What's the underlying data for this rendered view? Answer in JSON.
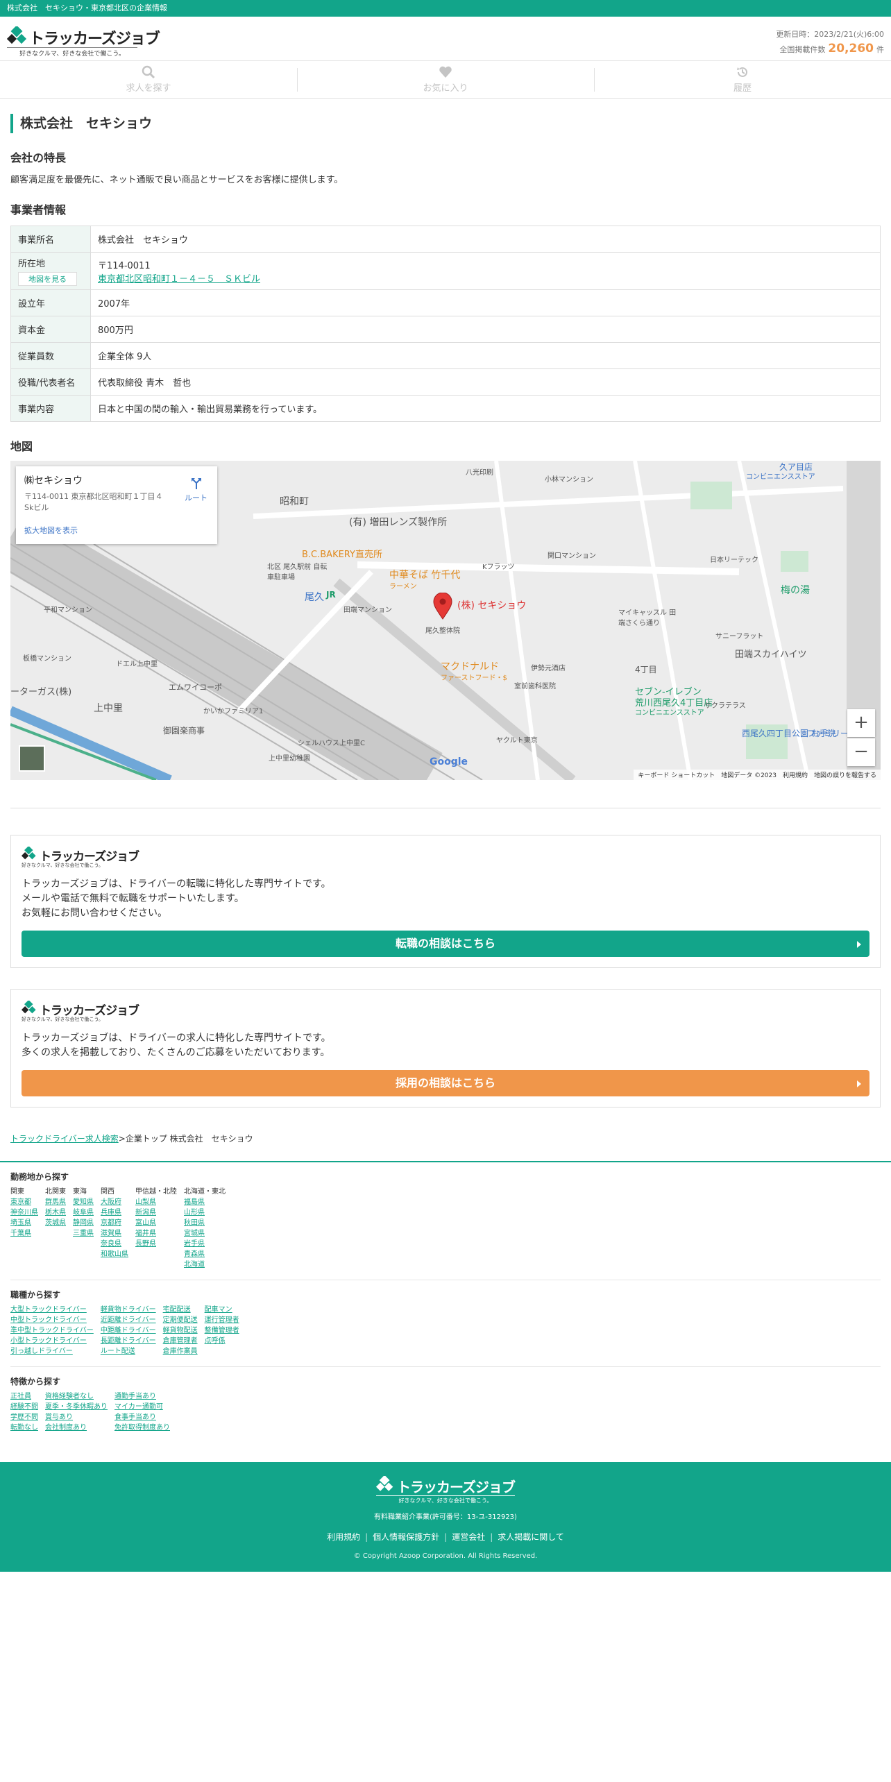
{
  "topbar": {
    "text": "株式会社　セキショウ・東京都北区の企業情報"
  },
  "brand": {
    "name": "トラッカーズジョブ",
    "tagline": "好きなクルマ、好きな会社で働こう。",
    "color": "#12a58a",
    "accent": "#f0964a"
  },
  "header": {
    "updated": "更新日時：2023/2/21(火)6:00",
    "count_label": "全国掲載件数",
    "count": "20,260",
    "count_unit": "件"
  },
  "nav": [
    {
      "label": "求人を探す",
      "icon": "search-icon"
    },
    {
      "label": "お気に入り",
      "icon": "heart-icon"
    },
    {
      "label": "履歴",
      "icon": "history-icon"
    }
  ],
  "company": {
    "title": "株式会社　セキショウ",
    "feature_heading": "会社の特長",
    "feature_text": "顧客満足度を最優先に、ネット通販で良い商品とサービスをお客様に提供します。",
    "info_heading": "事業者情報",
    "rows": [
      {
        "label": "事業所名",
        "value": "株式会社　セキショウ"
      },
      {
        "label": "所在地",
        "postal": "〒114-0011",
        "address": "東京都北区昭和町１－４－５　ＳＫビル",
        "map_button": "地図を見る"
      },
      {
        "label": "設立年",
        "value": "2007年"
      },
      {
        "label": "資本金",
        "value": "800万円"
      },
      {
        "label": "従業員数",
        "value": "企業全体 9人"
      },
      {
        "label": "役職/代表者名",
        "value": "代表取締役 青木　哲也"
      },
      {
        "label": "事業内容",
        "value": "日本と中国の間の輸入・輸出貿易業務を行っています。"
      }
    ]
  },
  "map": {
    "heading": "地図",
    "card_name": "㈱セキショウ",
    "card_address": "〒114-0011 東京都北区昭和町１丁目４ Skビル",
    "route": "ルート",
    "larger_map": "拡大地図を表示",
    "zoom_in": "+",
    "zoom_out": "−",
    "google": "Google",
    "footer": "キーボード ショートカット　地図データ ©2023　利用規約　地図の誤りを報告する",
    "labels": {
      "marker": "(株) セキショウ",
      "showa": "昭和町",
      "masuda": "(有) 増田レンズ製作所",
      "bakery": "B.C.BAKERY直売所",
      "ramen": "中華そば 竹千代",
      "ramen_sub": "ラーメン",
      "mcd": "マクドナルド",
      "mcd_sub": "ファーストフード・$",
      "oku": "尾久",
      "jr": "JR",
      "umenoyu": "梅の湯",
      "sevenA": "セブン-イレブン",
      "sevenA2": "荒川西尾久4丁目店",
      "sevenA3": "コンビニエンスストア",
      "tabata": "田端スカイハイツ",
      "kamina": "上中里",
      "yonchome": "4丁目",
      "doctor": "尾久整体院",
      "ebisu": "伊勢元酒店",
      "kouha": "エムワイコーポ",
      "kouha2": "御園楽商事",
      "nishiogu": "西尾久四丁目公園 お手洗",
      "kumikyu": "久ア目店",
      "conv": "コンビニエンスストア",
      "yakult": "ヤクルト東京",
      "shell": "シェルハウス上中里C",
      "kgas": "ーターガス(株)",
      "hirai": "平和マンション",
      "itabashi": "板橋マンション",
      "doel": "ドエル上中里",
      "kaiteki": "かいかファミリア1",
      "kgc": "上中里幼稚園",
      "akita": "北区 尾久駅前 自転車駐車場",
      "tabata_mansion": "田端マンション",
      "japan": "日本リーテック",
      "sunny": "サニーフラット",
      "mai": "マイキャッスル 田端さくら通り",
      "hachi": "八光印刷",
      "kfl": "Kフラッツ",
      "kinrin": "関口マンション",
      "ogu_dental": "室前歯科医院",
      "sak": "サクラテラス",
      "family": "ファミリー",
      "toki": "小林マンション"
    }
  },
  "cta": [
    {
      "text": [
        "トラッカーズジョブは、ドライバーの転職に特化した専門サイトです。",
        "メールや電話で無料で転職をサポートいたします。",
        "お気軽にお問い合わせください。"
      ],
      "button": "転職の相談はこちら"
    },
    {
      "text": [
        "トラッカーズジョブは、ドライバーの求人に特化した専門サイトです。",
        "多くの求人を掲載しており、たくさんのご応募をいただいております。"
      ],
      "button": "採用の相談はこちら"
    }
  ],
  "breadcrumb": {
    "link": "トラックドライバー求人検索",
    "rest": ">企業トップ 株式会社　セキショウ"
  },
  "search": {
    "area": {
      "heading": "勤務地から探す",
      "columns": [
        {
          "head": "関東",
          "items": [
            "東京都",
            "神奈川県",
            "埼玉県",
            "千葉県"
          ]
        },
        {
          "head": "北関東",
          "items": [
            "群馬県",
            "栃木県",
            "茨城県"
          ]
        },
        {
          "head": "東海",
          "items": [
            "愛知県",
            "岐阜県",
            "静岡県",
            "三重県"
          ]
        },
        {
          "head": "関西",
          "items": [
            "大阪府",
            "兵庫県",
            "京都府",
            "滋賀県",
            "奈良県",
            "和歌山県"
          ]
        },
        {
          "head": "甲信越・北陸",
          "items": [
            "山梨県",
            "新潟県",
            "富山県",
            "福井県",
            "長野県"
          ]
        },
        {
          "head": "北海道・東北",
          "items": [
            "福島県",
            "山形県",
            "秋田県",
            "宮城県",
            "岩手県",
            "青森県",
            "北海道"
          ]
        }
      ]
    },
    "job": {
      "heading": "職種から探す",
      "columns": [
        [
          "大型トラックドライバー",
          "中型トラックドライバー",
          "準中型トラックドライバー",
          "小型トラックドライバー",
          "引っ越しドライバー"
        ],
        [
          "軽貨物ドライバー",
          "近距離ドライバー",
          "中距離ドライバー",
          "長距離ドライバー",
          "ルート配送"
        ],
        [
          "宅配配送",
          "定期便配送",
          "軽貨物配送",
          "倉庫管理者",
          "倉庫作業員"
        ],
        [
          "配車マン",
          "運行管理者",
          "整備管理者",
          "点呼係"
        ]
      ]
    },
    "feature": {
      "heading": "特徴から探す",
      "columns": [
        [
          "正社員",
          "経験不問",
          "学歴不問",
          "転勤なし"
        ],
        [
          "資格経験者なし",
          "夏季・冬季休暇あり",
          "賞与あり",
          "会社制度あり"
        ],
        [
          "通勤手当あり",
          "マイカー通勤可",
          "食事手当あり",
          "免許取得制度あり"
        ]
      ]
    }
  },
  "footer": {
    "license": "有料職業紹介事業(許可番号：13-ユ-312923)",
    "links": [
      "利用規約",
      "個人情報保護方針",
      "運営会社",
      "求人掲載に関して"
    ],
    "copyright": "© Copyright Azoop Corporation. All Rights Reserved."
  }
}
